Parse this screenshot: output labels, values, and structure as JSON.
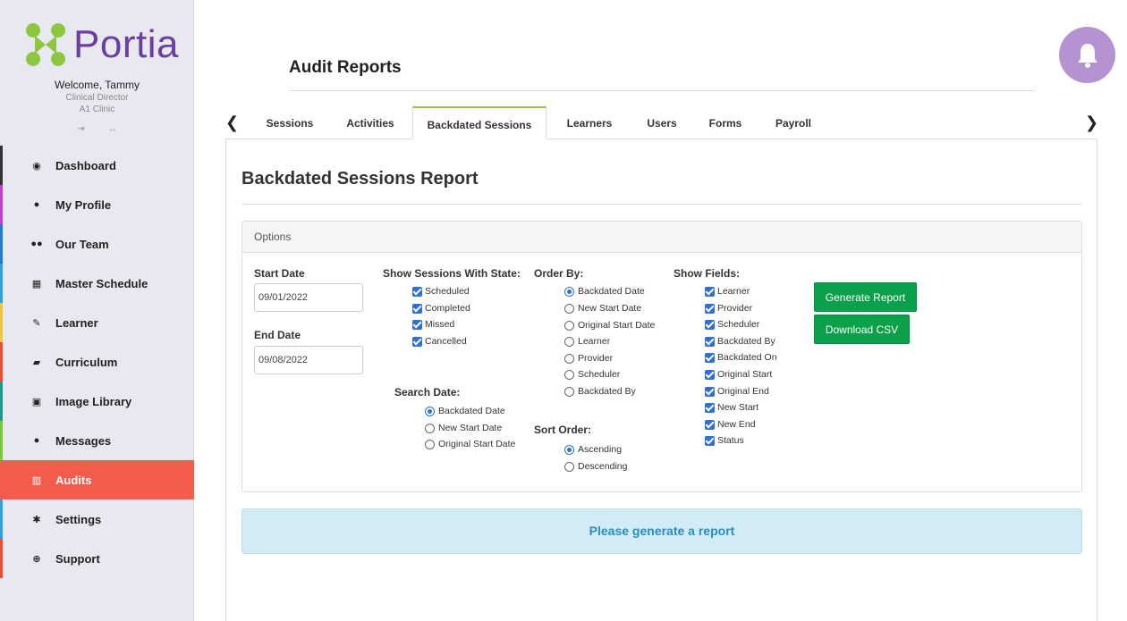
{
  "sidebar": {
    "logo_text": "Portia",
    "welcome": "Welcome, Tammy",
    "role": "Clinical Director",
    "clinic": "A1 Clinic",
    "items": [
      {
        "label": "Dashboard",
        "icon": "dashboard-icon",
        "accent": "#333333"
      },
      {
        "label": "My Profile",
        "icon": "user-icon",
        "accent": "#c23fd6"
      },
      {
        "label": "Our Team",
        "icon": "team-icon",
        "accent": "#1f7ad6"
      },
      {
        "label": "Master Schedule",
        "icon": "calendar-icon",
        "accent": "#2aa3d9"
      },
      {
        "label": "Learner",
        "icon": "pencil-icon",
        "accent": "#f0c63a"
      },
      {
        "label": "Curriculum",
        "icon": "book-icon",
        "accent": "#e8502f"
      },
      {
        "label": "Image Library",
        "icon": "image-icon",
        "accent": "#1d9b8a"
      },
      {
        "label": "Messages",
        "icon": "comment-icon",
        "accent": "#7acb3c"
      },
      {
        "label": "Audits",
        "icon": "chart-icon",
        "accent": "#f25c4d"
      },
      {
        "label": "Settings",
        "icon": "gear-icon",
        "accent": "#2aa3d9"
      },
      {
        "label": "Support",
        "icon": "lifebuoy-icon",
        "accent": "#e8502f"
      }
    ]
  },
  "header": {
    "title": "Audit Reports"
  },
  "tabs": [
    {
      "label": "Sessions"
    },
    {
      "label": "Activities"
    },
    {
      "label": "Backdated Sessions"
    },
    {
      "label": "Learners"
    },
    {
      "label": "Users"
    },
    {
      "label": "Forms"
    },
    {
      "label": "Payroll"
    }
  ],
  "report": {
    "title": "Backdated Sessions Report",
    "options_label": "Options",
    "start_date_label": "Start Date",
    "start_date_value": "09/01/2022",
    "end_date_label": "End Date",
    "end_date_value": "09/08/2022",
    "state_label": "Show Sessions With State:",
    "states": [
      "Scheduled",
      "Completed",
      "Missed",
      "Cancelled"
    ],
    "search_date_label": "Search Date:",
    "search_dates": [
      "Backdated Date",
      "New Start Date",
      "Original Start Date"
    ],
    "order_by_label": "Order By:",
    "order_by": [
      "Backdated Date",
      "New Start Date",
      "Original Start Date",
      "Learner",
      "Provider",
      "Scheduler",
      "Backdated By"
    ],
    "sort_order_label": "Sort Order:",
    "sort_order": [
      "Ascending",
      "Descending"
    ],
    "show_fields_label": "Show Fields:",
    "fields": [
      "Learner",
      "Provider",
      "Scheduler",
      "Backdated By",
      "Backdated On",
      "Original Start",
      "Original End",
      "New Start",
      "New End",
      "Status"
    ],
    "generate_label": "Generate Report",
    "download_label": "Download CSV",
    "alert": "Please generate a report"
  },
  "colors": {
    "brand_purple": "#6b3fa0",
    "brand_green": "#8dc63f",
    "active_nav": "#f25c4d",
    "button_green": "#0aa14a",
    "checkbox_blue": "#2f6fd6"
  }
}
